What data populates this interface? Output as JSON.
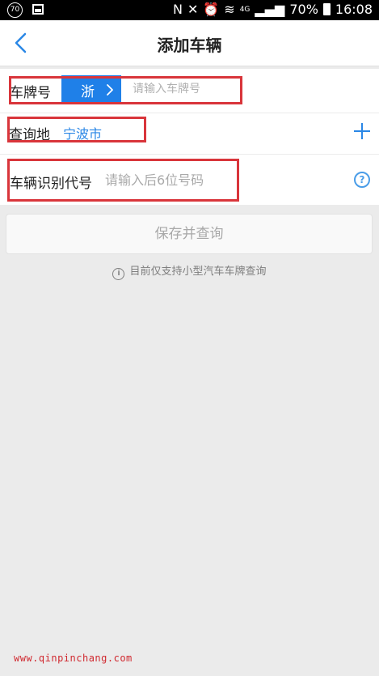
{
  "status_bar": {
    "badge": "70",
    "network": "4G",
    "battery": "70%",
    "time": "16:08"
  },
  "header": {
    "title": "添加车辆",
    "back_icon": "chevron-left-icon"
  },
  "form": {
    "plate": {
      "label": "车牌号",
      "province": "浙",
      "placeholder": "请输入车牌号"
    },
    "city": {
      "label": "查询地",
      "value": "宁波市",
      "add_icon": "plus-icon"
    },
    "vin": {
      "label": "车辆识别代号",
      "placeholder": "请输入后6位号码",
      "help_icon": "question-circle-icon"
    }
  },
  "actions": {
    "save_label": "保存并查询"
  },
  "notice": {
    "icon": "info-icon",
    "text": "目前仅支持小型汽车车牌查询"
  },
  "watermark": "www.qinpinchang.com",
  "colors": {
    "accent": "#1f80e8",
    "link": "#2a87e6",
    "annotation": "#d9353b",
    "background": "#ebebeb"
  }
}
